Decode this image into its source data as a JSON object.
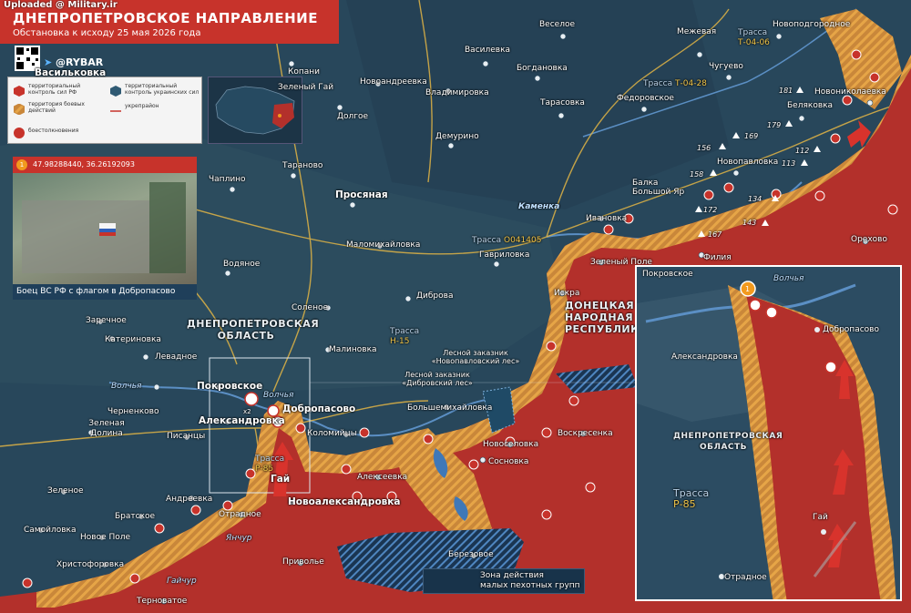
{
  "header": {
    "title": "ДНЕПРОПЕТРОВСКОЕ НАПРАВЛЕНИЕ",
    "subtitle": "Обстановка к исходу 25 мая 2026 года",
    "watermark": "Uploaded @ Military.ir",
    "brand": "@RYBAR"
  },
  "legend": {
    "ru_control": "территориальный контроль сил РФ",
    "ua_control": "территориальный контроль украинских сил",
    "combat": "территория боевых действий",
    "fortified": "укрепрайон",
    "clashes": "боестолкновения"
  },
  "photo": {
    "marker": "1",
    "coords": "47.98288440, 36.26192093",
    "caption": "Боец ВС РФ с флагом в Добропасово"
  },
  "colors": {
    "ru": "#b3302b",
    "contested": "#d9953c",
    "ua_bg": "#28475b",
    "header": "#c7332b",
    "roads": "#e0b445"
  },
  "places": {
    "vasilkovka": "Васильковка",
    "kopani": "Копани",
    "zeleny_gay_n": "Зеленый Гай",
    "novoandreevka": "Новоандреевка",
    "vladimirovka": "Владимировка",
    "vasilevka": "Василевка",
    "veseloe": "Веселое",
    "mezhevaya": "Межевая",
    "novopodgorodnoe": "Новоподгородное",
    "bogdanovka": "Богдановка",
    "chuguevo": "Чугуево",
    "dolgoe": "Долгое",
    "tarasovka": "Тарасовка",
    "fedorovskoe": "Федоровское",
    "belyakovka": "Беляковка",
    "novonikolaevka": "Новониколаевка",
    "demurino": "Демурино",
    "taranovo": "Тараново",
    "chaplino": "Чаплино",
    "prosyanaya": "Просяная",
    "novopavlovka": "Новопавловка",
    "kamenka": "Каменка",
    "balka_bolshoy_yar": "Балка Большой Яр",
    "ivanovka": "Ивановка",
    "gavrilovka": "Гавриловка",
    "malomikhailovka": "Маломихайловка",
    "vodyanoe": "Водяное",
    "zeleny_pole": "Зеленый Поле",
    "filia": "Филия",
    "orekhovo": "Орехово",
    "iskra": "Искра",
    "dibrova": "Диброва",
    "solenoe": "Соленое",
    "zarechnoe": "Заречное",
    "katerinovka": "Катериновка",
    "levadnoe": "Левадное",
    "malinovka": "Малиновка",
    "volchya": "Волчья",
    "chernenkovo": "Черненково",
    "pokrovskoe": "Покровское",
    "alexandrovka": "Александровка",
    "dobropasovo": "Добропасово",
    "kolomiytsy": "Коломийцы",
    "bolshemikhailovka": "Большемихайловка",
    "voskresenka": "Воскресенка",
    "novoselovka": "Новоселовка",
    "zelenaya_dolina": "Зеленая Долина",
    "pisantsy": "Писанцы",
    "gay": "Гай",
    "alexeevka": "Алексеевка",
    "sosnovka": "Сосновка",
    "zelenoe": "Зеленое",
    "andreevka": "Андреевка",
    "novoalexandrovka": "Новоалександровка",
    "bratskoe": "Братское",
    "otradnoe": "Отрадное",
    "samoylovka": "Самойловка",
    "novoe_pole": "Новое Поле",
    "khristoforovka": "Христофоровка",
    "yanchur": "Янчур",
    "gaychur": "Гайчур",
    "privolye": "Приволье",
    "berezovoe": "Березовое",
    "ternovatoe": "Терноватое",
    "volchya_2": "Волчья"
  },
  "regions": {
    "dnepr": "ДНЕПРОПЕТРОВСКАЯ ОБЛАСТЬ",
    "dnr": "ДОНЕЦКАЯ НАРОДНАЯ РЕСПУБЛИКА"
  },
  "roads": {
    "t0406_a": "Трасса",
    "t0406_b": "Т-04-06",
    "t0428_a": "Трасса",
    "t0428_b": "Т-04-28",
    "o041405_a": "Трасса",
    "o041405_b": "О041405",
    "h15_a": "Трасса",
    "h15_b": "Н-15",
    "p85_a": "Трасса",
    "p85_b": "Р-85"
  },
  "reserves": {
    "novopavlovsky": "Лесной заказник «Новопавловский лес»",
    "dibrovsky": "Лесной заказник «Дибровский лес»"
  },
  "heights": [
    "181",
    "179",
    "156",
    "169",
    "112",
    "113",
    "158",
    "172",
    "134",
    "143",
    "167"
  ],
  "zone_legend": {
    "line1": "Зона действия",
    "line2": "малых пехотных групп"
  },
  "detail": {
    "marker": "1",
    "pokrovskoe": "Покровское",
    "volchya": "Волчья",
    "dobropasovo": "Добропасово",
    "alexandrovka": "Александровка",
    "region": "ДНЕПРОПЕТРОВСКАЯ ОБЛАСТЬ",
    "road_a": "Трасса",
    "road_b": "Р-85",
    "gay": "Гай",
    "otradnoe": "Отрадное"
  },
  "misc": {
    "x2": "x2"
  }
}
